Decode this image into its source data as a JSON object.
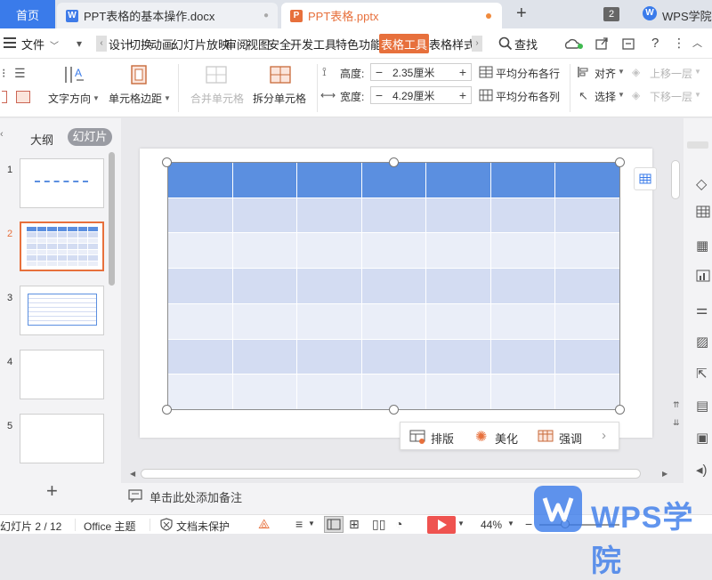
{
  "tabs": {
    "home": "首页",
    "doc": "PPT表格的基本操作.docx",
    "ppt": "PPT表格.pptx",
    "add": "+",
    "count": "2",
    "brand": "WPS学院"
  },
  "menu": {
    "file": "文件",
    "items": [
      "设计",
      "切换",
      "动画",
      "幻灯片放映",
      "审阅",
      "视图",
      "安全",
      "开发工具",
      "特色功能",
      "表格工具",
      "表格样式"
    ],
    "search": "查找"
  },
  "ribbon": {
    "text_direction": "文字方向",
    "cell_margin": "单元格边距",
    "merge_cells": "合并单元格",
    "split_cells": "拆分单元格",
    "height_label": "高度:",
    "height_value": "2.35厘米",
    "width_label": "宽度:",
    "width_value": "4.29厘米",
    "dist_rows": "平均分布各行",
    "dist_cols": "平均分布各列",
    "align": "对齐",
    "select": "选择",
    "bring_up": "上移一层",
    "send_down": "下移一层"
  },
  "panel": {
    "outline_tab": "大纲",
    "slides_tab": "幻灯片",
    "slide_numbers": [
      "1",
      "2",
      "3",
      "4",
      "5"
    ],
    "add_icon": "+"
  },
  "table": {
    "rows": 7,
    "cols": 7,
    "colors": {
      "header": "#5b8fe0",
      "band1": "#d3dcf2",
      "band2": "#eaeef8",
      "border": "#ffffff"
    }
  },
  "float_toolbar": {
    "layout": "排版",
    "beautify": "美化",
    "emphasize": "强调"
  },
  "notes": {
    "placeholder": "单击此处添加备注"
  },
  "status": {
    "slide": "幻灯片 2 / 12",
    "theme": "Office 主题",
    "protect": "文档未保护",
    "zoom": "44%"
  },
  "watermark": "WPS学院",
  "colors": {
    "accent": "#e7703c",
    "blue": "#3a7bea",
    "play": "#ef5350"
  }
}
